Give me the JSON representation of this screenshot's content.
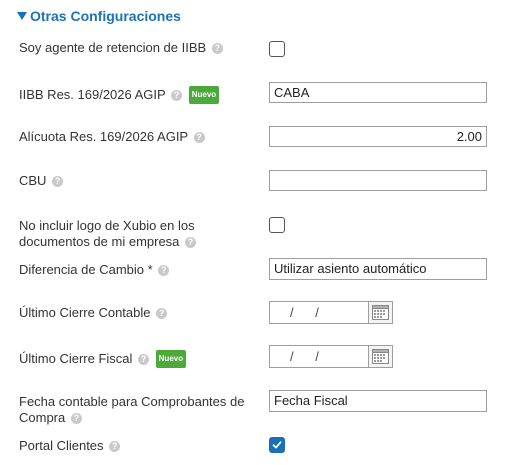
{
  "section": {
    "title": "Otras Configuraciones",
    "expanded": true
  },
  "fields": {
    "iibb_agent": {
      "label": "Soy agente de retencion de IIBB",
      "checked": false
    },
    "iibb_res": {
      "label": "IIBB Res. 169/2026 AGIP",
      "badge": "Nuevo",
      "value": "CABA"
    },
    "alicuota": {
      "label": "Alícuota Res. 169/2026 AGIP",
      "value": "2.00"
    },
    "cbu": {
      "label": "CBU",
      "value": ""
    },
    "no_logo": {
      "label_line1": "No incluir logo de Xubio en los",
      "label_line2": "documentos de mi empresa",
      "checked": false
    },
    "diferencia_cambio": {
      "label": "Diferencia de Cambio *",
      "value": "Utilizar asiento automático"
    },
    "cierre_contable": {
      "label": "Último Cierre Contable",
      "value": "/ /"
    },
    "cierre_fiscal": {
      "label": "Último Cierre Fiscal",
      "badge": "Nuevo",
      "value": "/ /"
    },
    "fecha_contable": {
      "label_line1": "Fecha contable para Comprobantes de",
      "label_line2": "Compra",
      "value": "Fecha Fiscal"
    },
    "portal_clientes": {
      "label": "Portal Clientes",
      "checked": true
    }
  },
  "help_glyph": "?",
  "colors": {
    "accent": "#1a73b8",
    "badge": "#4ca93a",
    "checkbox_checked": "#1a6fb5"
  },
  "icons": {
    "section_toggle": "caret-down-icon",
    "help": "help-icon",
    "calendar": "calendar-icon",
    "check": "check-icon"
  }
}
